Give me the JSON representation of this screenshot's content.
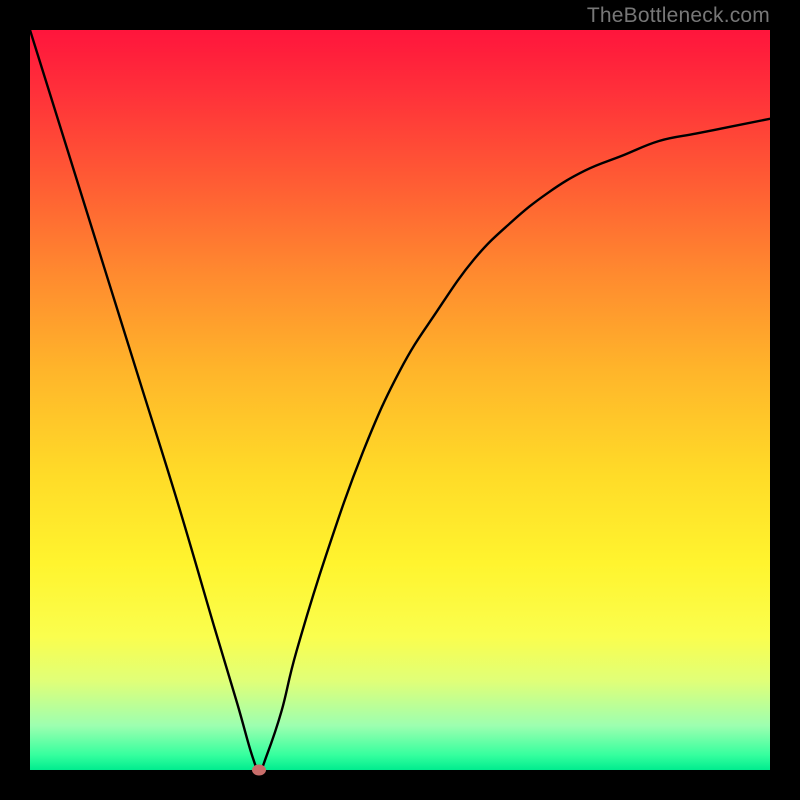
{
  "watermark": "TheBottleneck.com",
  "chart_data": {
    "type": "line",
    "title": "",
    "xlabel": "",
    "ylabel": "",
    "ylim": [
      0,
      100
    ],
    "xlim": [
      0,
      100
    ],
    "x": [
      0,
      5,
      10,
      15,
      20,
      25,
      28,
      30,
      31,
      32,
      34,
      36,
      40,
      45,
      50,
      55,
      60,
      65,
      70,
      75,
      80,
      85,
      90,
      95,
      100
    ],
    "values": [
      100,
      84,
      68,
      52,
      36,
      19,
      9,
      2,
      0,
      2,
      8,
      16,
      29,
      43,
      54,
      62,
      69,
      74,
      78,
      81,
      83,
      85,
      86,
      87,
      88
    ],
    "minimum_point": {
      "x": 31,
      "y": 0
    },
    "gradient_stops": [
      {
        "pos": 0,
        "color": "#ff153c"
      },
      {
        "pos": 8,
        "color": "#ff2f3a"
      },
      {
        "pos": 20,
        "color": "#ff5a34"
      },
      {
        "pos": 33,
        "color": "#ff8a2f"
      },
      {
        "pos": 46,
        "color": "#ffb52a"
      },
      {
        "pos": 60,
        "color": "#ffdb28"
      },
      {
        "pos": 72,
        "color": "#fff42e"
      },
      {
        "pos": 82,
        "color": "#fafe4e"
      },
      {
        "pos": 88,
        "color": "#e0ff78"
      },
      {
        "pos": 94,
        "color": "#9dffb0"
      },
      {
        "pos": 98,
        "color": "#35ff9e"
      },
      {
        "pos": 100,
        "color": "#00ec8f"
      }
    ],
    "curve_color": "#000000",
    "dot_color": "#c86d6a"
  }
}
